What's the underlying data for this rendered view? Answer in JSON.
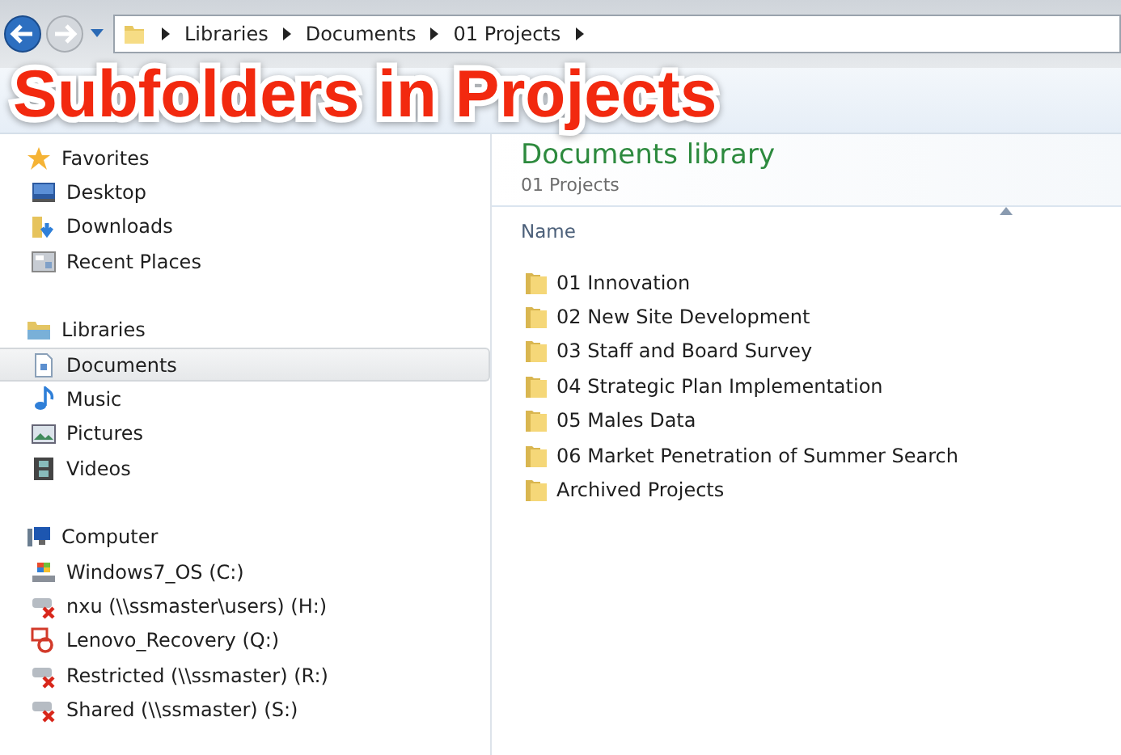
{
  "address_bar": {
    "crumbs": [
      "Libraries",
      "Documents",
      "01 Projects"
    ]
  },
  "caption": "Subfolders in Projects",
  "nav_pane": {
    "groups": [
      {
        "label": "Favorites",
        "items": [
          {
            "label": "Desktop",
            "selected": false
          },
          {
            "label": "Downloads",
            "selected": false
          },
          {
            "label": "Recent Places",
            "selected": false
          }
        ]
      },
      {
        "label": "Libraries",
        "items": [
          {
            "label": "Documents",
            "selected": true
          },
          {
            "label": "Music",
            "selected": false
          },
          {
            "label": "Pictures",
            "selected": false
          },
          {
            "label": "Videos",
            "selected": false
          }
        ]
      },
      {
        "label": "Computer",
        "items": [
          {
            "label": "Windows7_OS (C:)",
            "selected": false
          },
          {
            "label": "nxu (\\\\ssmaster\\users) (H:)",
            "selected": false
          },
          {
            "label": "Lenovo_Recovery (Q:)",
            "selected": false
          },
          {
            "label": "Restricted (\\\\ssmaster) (R:)",
            "selected": false
          },
          {
            "label": "Shared (\\\\ssmaster) (S:)",
            "selected": false
          }
        ]
      }
    ]
  },
  "content": {
    "title": "Documents library",
    "subtitle": "01 Projects",
    "columns": [
      "Name"
    ],
    "items": [
      "01 Innovation",
      "02 New Site Development",
      "03 Staff and Board Survey",
      "04 Strategic Plan Implementation",
      "05 Males Data",
      "06 Market Penetration of Summer Search",
      "Archived Projects"
    ]
  }
}
